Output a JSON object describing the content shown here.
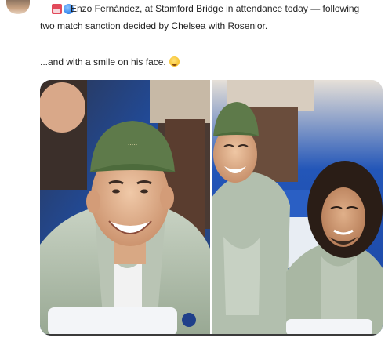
{
  "tweet": {
    "line1": "Enzo Fernández, at Stamford Bridge in attendance today —  following",
    "line2": "two match sanction decided by Chelsea with Rosenior.",
    "line3": "...and with a smile on his face.",
    "emoji_names": [
      "calendar-icon",
      "soccer-ball-icon",
      "grinning-face-icon"
    ]
  },
  "media": {
    "photo_count": 2,
    "left_photo": {
      "subject": "man in green cap smiling, light green puffer jacket"
    },
    "right_photo": {
      "subjects": [
        "man in green cap laughing",
        "man with long curly hair smiling"
      ]
    }
  },
  "colors": {
    "text": "#222222",
    "stand_blue": "#1f4fa8",
    "jacket_green": "#a9b7a3",
    "cap_green": "#5e7a4a"
  }
}
